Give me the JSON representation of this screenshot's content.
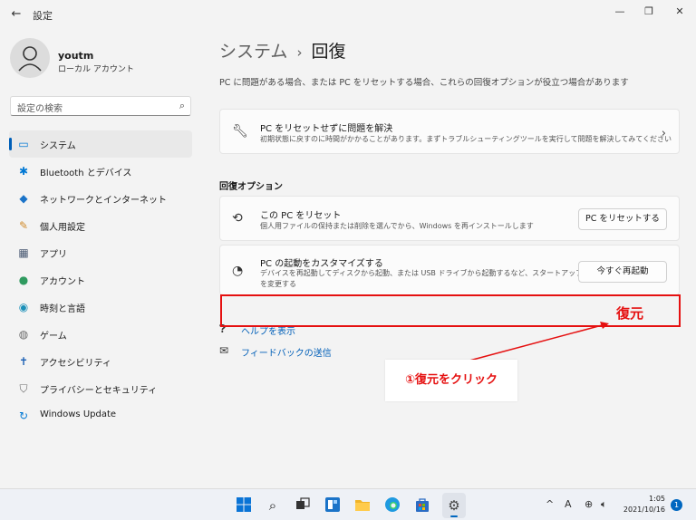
{
  "window": {
    "back_glyph": "←",
    "title": "設定",
    "minimize_glyph": "—",
    "maximize_glyph": "❐",
    "close_glyph": "✕"
  },
  "profile": {
    "name": "youtm",
    "account_type": "ローカル アカウント"
  },
  "search": {
    "placeholder": "設定の検索",
    "icon": "search-icon"
  },
  "sidebar": {
    "items": [
      {
        "label": "システム",
        "icon": "monitor-icon",
        "glyph": "▭",
        "color": "#0078d4",
        "active": true
      },
      {
        "label": "Bluetooth とデバイス",
        "icon": "bluetooth-icon",
        "glyph": "✱",
        "color": "#0078d4",
        "active": false
      },
      {
        "label": "ネットワークとインターネット",
        "icon": "wifi-icon",
        "glyph": "◆",
        "color": "#1a73c8",
        "active": false
      },
      {
        "label": "個人用設定",
        "icon": "brush-icon",
        "glyph": "✎",
        "color": "#d08a2a",
        "active": false
      },
      {
        "label": "アプリ",
        "icon": "apps-icon",
        "glyph": "▦",
        "color": "#4a5a73",
        "active": false
      },
      {
        "label": "アカウント",
        "icon": "person-icon",
        "glyph": "●",
        "color": "#2f9a5f",
        "active": false
      },
      {
        "label": "時刻と言語",
        "icon": "globe-clock-icon",
        "glyph": "◉",
        "color": "#1a8fb8",
        "active": false
      },
      {
        "label": "ゲーム",
        "icon": "gamepad-icon",
        "glyph": "◍",
        "color": "#6b6b6b",
        "active": false
      },
      {
        "label": "アクセシビリティ",
        "icon": "accessibility-icon",
        "glyph": "✝",
        "color": "#1a5fb4",
        "active": false
      },
      {
        "label": "プライバシーとセキュリティ",
        "icon": "shield-icon",
        "glyph": "⛉",
        "color": "#6b6b6b",
        "active": false
      },
      {
        "label": "Windows Update",
        "icon": "update-icon",
        "glyph": "↻",
        "color": "#0078d4",
        "active": false
      }
    ]
  },
  "main": {
    "breadcrumb_parent": "システム",
    "breadcrumb_separator": "›",
    "breadcrumb_current": "回復",
    "description": "PC に問題がある場合、または PC をリセットする場合、これらの回復オプションが役立つ場合があります",
    "troubleshoot_card": {
      "title": "PC をリセットせずに問題を解決",
      "desc": "初期状態に戻すのに時間がかかることがあります。まずトラブルシューティングツールを実行して問題を解決してみてください",
      "icon": "wrench-icon",
      "chevron": "›"
    },
    "section_title": "回復オプション",
    "reset_card": {
      "title": "この PC をリセット",
      "desc": "個人用ファイルの保持または削除を選んでから、Windows を再インストールします",
      "button": "PC をリセットする",
      "icon": "reset-pc-icon"
    },
    "startup_card": {
      "title": "PC の起動をカスタマイズする",
      "desc_line1": "デバイスを再起動してディスクから起動、または USB ドライブから起動するなど、スタートアップ設定",
      "desc_line2": "を変更する",
      "button": "今すぐ再起動",
      "icon": "startup-icon"
    },
    "help_link": "ヘルプを表示",
    "feedback_link": "フィードバックの送信"
  },
  "annotations": {
    "target_label": "復元",
    "callout": "①復元をクリック",
    "color": "#e51010"
  },
  "taskbar": {
    "icons": [
      "start-icon",
      "search-icon",
      "task-view-icon",
      "widgets-icon",
      "file-explorer-icon",
      "edge-icon",
      "store-icon",
      "settings-icon"
    ],
    "tray_chevron": "^",
    "ime": "A",
    "time": "1:05",
    "date": "2021/10/16",
    "notifications": "1"
  }
}
